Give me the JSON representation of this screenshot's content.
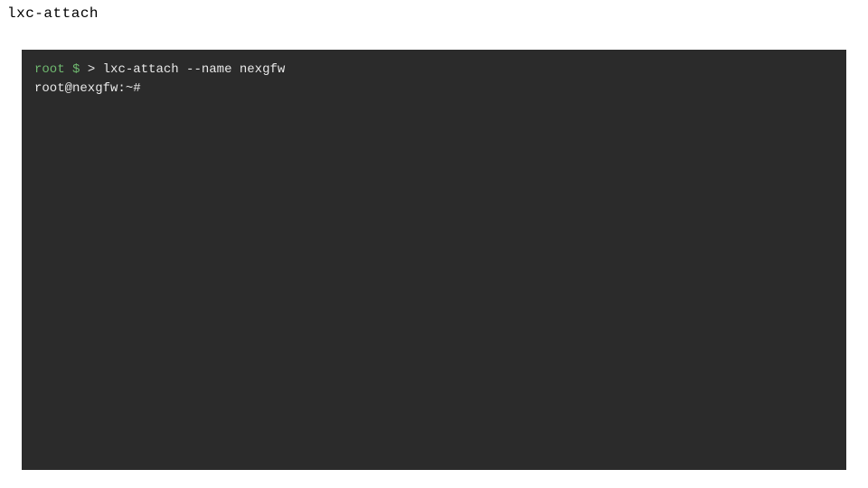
{
  "header": {
    "title": "lxc-attach"
  },
  "terminal": {
    "lines": [
      {
        "user": "root",
        "dollar": " $",
        "angle": " > ",
        "command": "lxc-attach --name nexgfw"
      },
      {
        "prompt": "root@nexgfw:~#"
      }
    ]
  }
}
